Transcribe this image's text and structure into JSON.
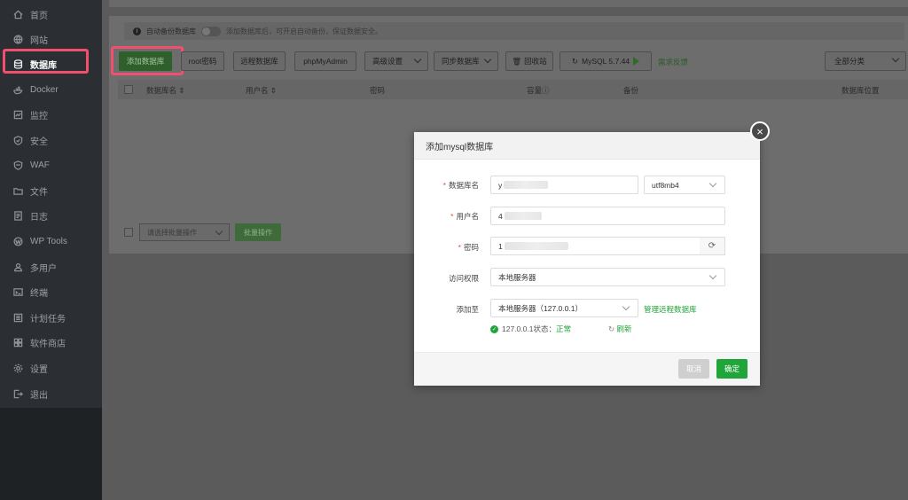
{
  "sidebar": {
    "items": [
      {
        "label": "首页",
        "icon": "home-icon"
      },
      {
        "label": "网站",
        "icon": "globe-icon"
      },
      {
        "label": "数据库",
        "icon": "database-icon",
        "active": true
      },
      {
        "label": "Docker",
        "icon": "docker-icon"
      },
      {
        "label": "监控",
        "icon": "monitor-icon"
      },
      {
        "label": "安全",
        "icon": "shield-icon"
      },
      {
        "label": "WAF",
        "icon": "waf-shield-icon"
      },
      {
        "label": "文件",
        "icon": "folder-icon"
      },
      {
        "label": "日志",
        "icon": "log-icon"
      },
      {
        "label": "WP Tools",
        "icon": "wordpress-icon"
      },
      {
        "label": "多用户",
        "icon": "users-icon"
      },
      {
        "label": "终端",
        "icon": "terminal-icon"
      },
      {
        "label": "计划任务",
        "icon": "task-icon"
      },
      {
        "label": "软件商店",
        "icon": "store-icon"
      },
      {
        "label": "设置",
        "icon": "gear-icon"
      },
      {
        "label": "退出",
        "icon": "logout-icon"
      }
    ]
  },
  "infobar": {
    "auto_backup_label": "自动备份数据库",
    "tip": "添加数据库后，可开启自动备份，保证数据安全。"
  },
  "toolbar": {
    "add_db": "添加数据库",
    "root_pwd": "root密码",
    "remote_db": "远程数据库",
    "phpmyadmin": "phpMyAdmin",
    "advanced": "高级设置",
    "sync_db": "同步数据库",
    "recycle": "回收站",
    "mysql_version": "MySQL 5.7.44",
    "feedback": "需求反馈",
    "category": "全部分类"
  },
  "table": {
    "headers": [
      "数据库名",
      "用户名",
      "密码",
      "容量",
      "备份",
      "数据库位置"
    ]
  },
  "bulk": {
    "select_placeholder": "请选择批量操作",
    "button": "批量操作"
  },
  "modal": {
    "title": "添加mysql数据库",
    "fields": {
      "db_name_label": "数据库名",
      "db_name_value": "y",
      "charset": "utf8mb4",
      "username_label": "用户名",
      "username_value": "4",
      "password_label": "密码",
      "password_value": "1",
      "access_label": "访问权限",
      "access_value": "本地服务器",
      "add_to_label": "添加至",
      "add_to_value": "本地服务器（127.0.0.1）",
      "manage_remote": "管理远程数据库"
    },
    "status": {
      "host": "127.0.0.1状态：",
      "state": "正常",
      "refresh": "刷新"
    },
    "cancel": "取消",
    "confirm": "确定"
  },
  "colors": {
    "accent_green": "#20a53a",
    "highlight_red": "#f0506e",
    "sidebar_bg": "#2b2f33"
  }
}
